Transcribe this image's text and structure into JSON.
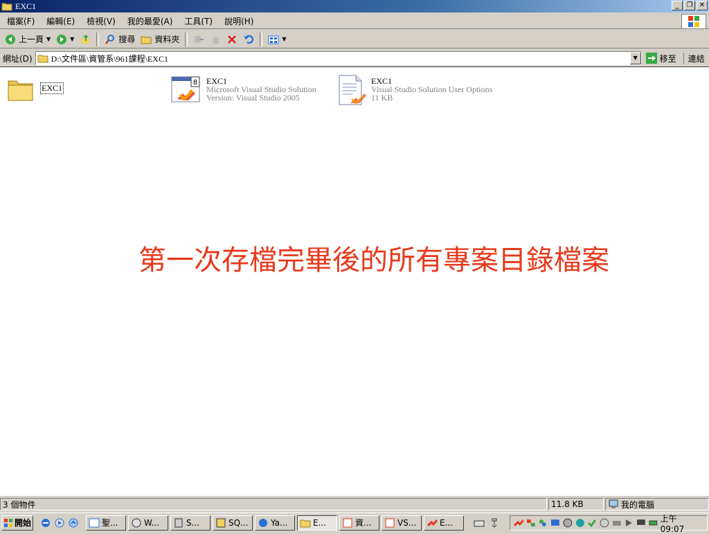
{
  "window": {
    "title": "EXC1"
  },
  "menu": [
    "檔案(F)",
    "編輯(E)",
    "檢視(V)",
    "我的最愛(A)",
    "工具(T)",
    "說明(H)"
  ],
  "toolbar": {
    "back_label": "上一頁",
    "search_label": "搜尋",
    "folders_label": "資料夾"
  },
  "address": {
    "label": "網址(D)",
    "value": "D:\\文件區\\資管系\\961課程\\EXC1",
    "go_label": "移至",
    "links_label": "連結"
  },
  "files": {
    "folder": {
      "name": "EXC1"
    },
    "sln": {
      "name": "EXC1",
      "type": "Microsoft Visual Studio Solution",
      "detail": "Version: Visual Studio 2005",
      "badge": "8"
    },
    "suo": {
      "name": "EXC1",
      "type": "Visual Studio Solution User Options",
      "detail": "11 KB"
    }
  },
  "overlay_text": "第一次存檔完畢後的所有專案目錄檔案",
  "status": {
    "objects": "3 個物件",
    "size": "11.8 KB",
    "location": "我的電腦"
  },
  "taskbar": {
    "start_label": "開始",
    "tasks": [
      "聖...",
      "W...",
      "S...",
      "SQ...",
      "Ya...",
      "E...",
      "資...",
      "VS...",
      "E..."
    ],
    "clock": "上午 09:07"
  },
  "colors": {
    "overlay": "#e8391c",
    "title_gradient_start": "#0a246a",
    "title_gradient_end": "#a6caf0"
  }
}
